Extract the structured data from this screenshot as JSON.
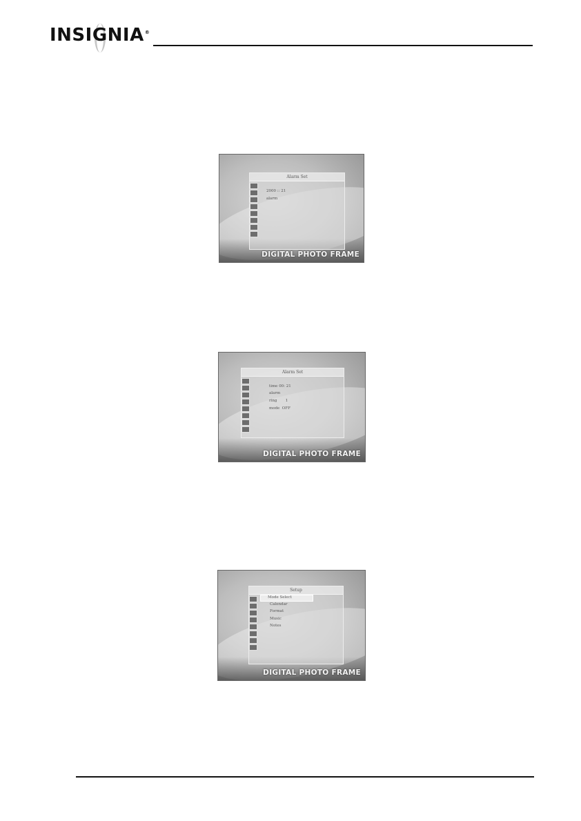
{
  "header": {
    "brand": "INSIGNIA",
    "brand_mark": "®"
  },
  "screens": [
    {
      "panel_title": "Alarm Set",
      "menu_lines": [
        "2000 :: 21",
        "alarm"
      ],
      "logo": "DIGITAL PHOTO FRAME",
      "selected_index": -1
    },
    {
      "panel_title": "Alarm Set",
      "menu_lines": [
        "time 00: 21",
        "alarm",
        "ring       1",
        "mode  OFF"
      ],
      "logo": "DIGITAL PHOTO FRAME",
      "selected_index": -1
    },
    {
      "panel_title": "Setup",
      "menu_lines": [
        "Mode Select",
        "Calendar",
        "Format",
        "Music",
        "Notes"
      ],
      "logo": "DIGITAL PHOTO FRAME",
      "selected_index": 0
    }
  ]
}
